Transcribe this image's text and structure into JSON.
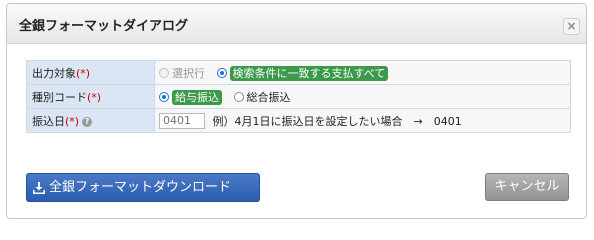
{
  "dialog": {
    "title": "全銀フォーマットダイアログ",
    "close_label": "×"
  },
  "form": {
    "required_mark": "(*)",
    "rows": [
      {
        "label": "出力対象",
        "options": [
          {
            "label": "選択行",
            "checked": false,
            "disabled": true
          },
          {
            "label": "検索条件に一致する支払すべて",
            "checked": true,
            "highlighted": true
          }
        ]
      },
      {
        "label": "種別コード",
        "options": [
          {
            "label": "給与振込",
            "checked": true,
            "highlighted": true
          },
          {
            "label": "総合振込",
            "checked": false
          }
        ]
      },
      {
        "label": "振込日",
        "help_icon": "question-icon",
        "input_placeholder": "0401",
        "example_text": "例）4月1日に振込日を設定したい場合　→　0401"
      }
    ]
  },
  "buttons": {
    "download_label": "全銀フォーマットダウンロード",
    "download_icon": "download-icon",
    "cancel_label": "キャンセル"
  },
  "colors": {
    "primary": "#2b5cae",
    "highlight": "#3b9a4a",
    "required": "#cc0000",
    "label_bg": "#dbe6f4"
  }
}
